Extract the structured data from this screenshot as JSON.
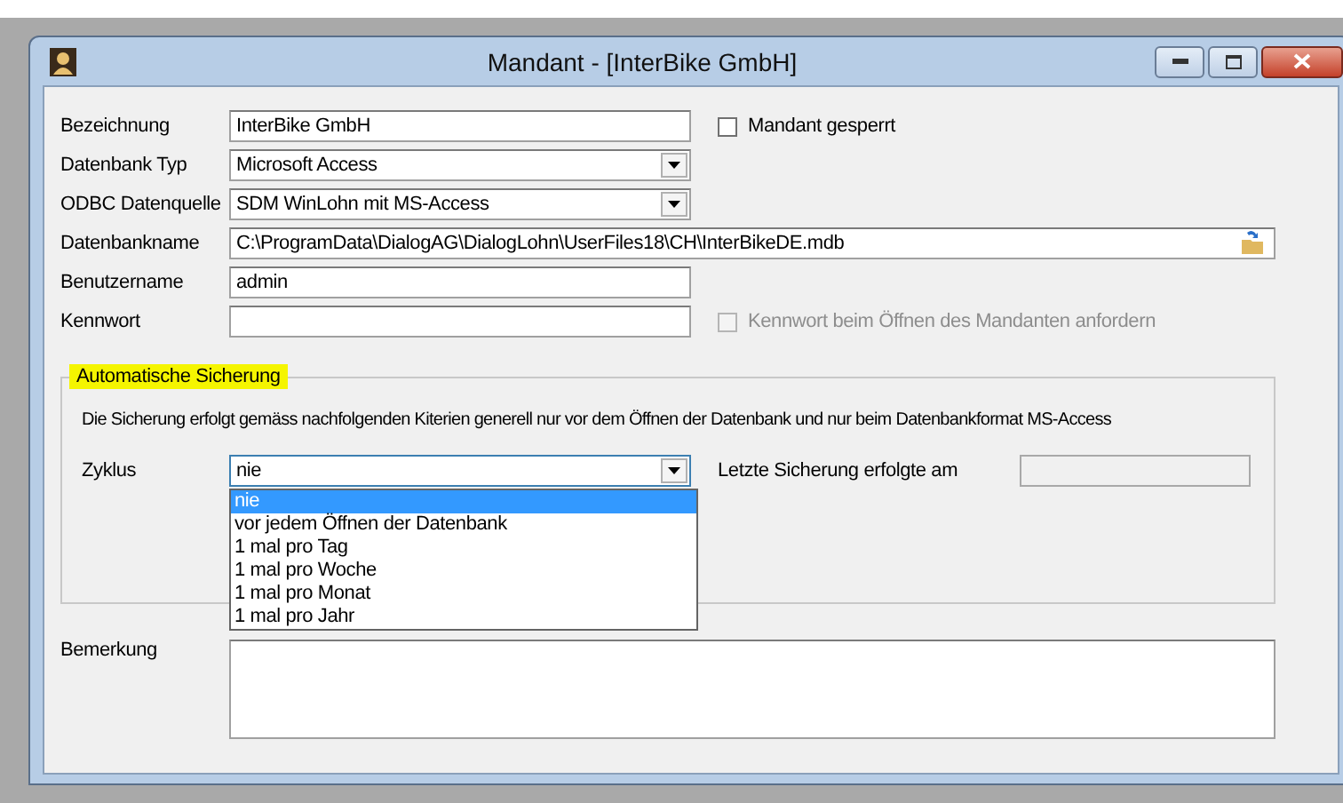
{
  "window": {
    "title": "Mandant - [InterBike GmbH]"
  },
  "fields": [
    {
      "kind": "text",
      "label": "Bezeichnung",
      "value": "InterBike GmbH"
    },
    {
      "kind": "combo",
      "label": "Datenbank Typ",
      "value": "Microsoft Access"
    },
    {
      "kind": "combo",
      "label": "ODBC Datenquelle",
      "value": "SDM WinLohn mit MS-Access"
    },
    {
      "kind": "file",
      "label": "Datenbankname",
      "value": "C:\\ProgramData\\DialogAG\\DialogLohn\\UserFiles18\\CH\\InterBikeDE.mdb"
    },
    {
      "kind": "text",
      "label": "Benutzername",
      "value": "admin"
    },
    {
      "kind": "password",
      "label": "Kennwort"
    }
  ],
  "checkboxes": [
    {
      "label": "Mandant gesperrt",
      "checked": false,
      "disabled": false
    },
    {
      "label": "Kennwort beim Öffnen des Mandanten anfordern",
      "checked": false,
      "disabled": true
    }
  ],
  "backup_group": {
    "title": "Automatische Sicherung",
    "highlighted": true,
    "description": "Die Sicherung erfolgt gemäss nachfolgenden Kiterien generell nur vor dem Öffnen der Datenbank und nur beim Datenbankformat MS-Access",
    "cycle": {
      "label": "Zyklus",
      "value": "nie",
      "expanded": true,
      "options": [
        {
          "label": "nie",
          "selected": true
        },
        {
          "label": "vor jedem Öffnen der Datenbank",
          "selected": false
        },
        {
          "label": "1 mal pro Tag",
          "selected": false
        },
        {
          "label": "1 mal pro Woche",
          "selected": false
        },
        {
          "label": "1 mal pro Monat",
          "selected": false
        },
        {
          "label": "1 mal pro Jahr",
          "selected": false
        }
      ]
    },
    "last_backup": {
      "label": "Letzte Sicherung erfolgte am",
      "disabled": true
    }
  },
  "remark": {
    "label": "Bemerkung"
  }
}
